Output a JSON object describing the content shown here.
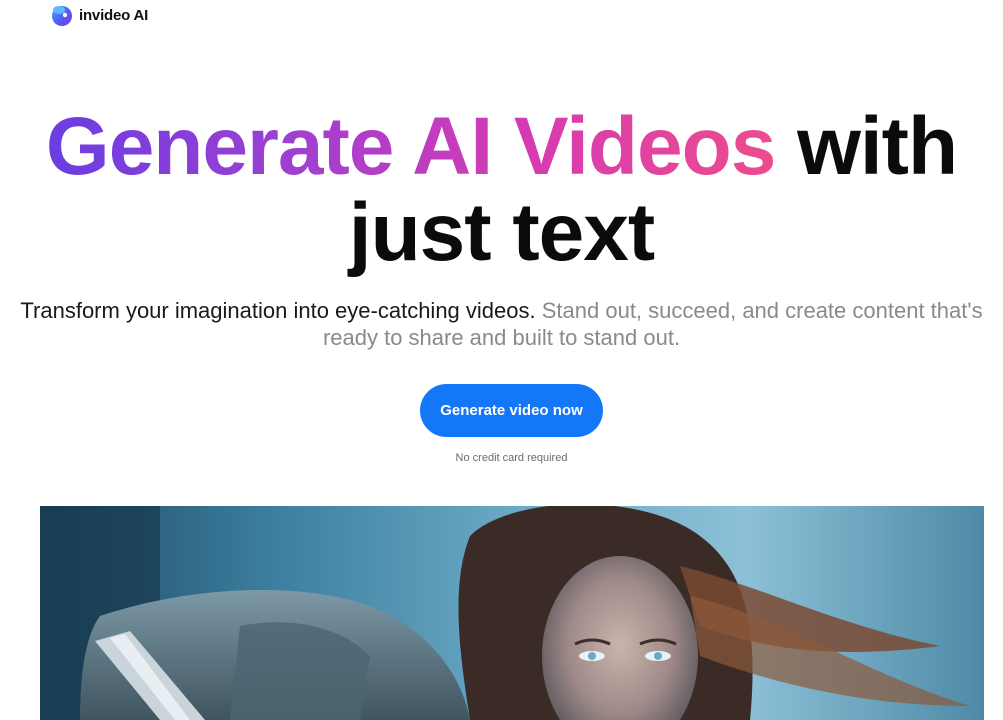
{
  "header": {
    "brand_name": "invideo AI",
    "logo_icon": "invideo-logo-icon"
  },
  "hero": {
    "headline_gradient": "Generate AI Videos",
    "headline_rest_line1": " with",
    "headline_line2": "just text",
    "subtitle_dark": "Transform your imagination into eye-catching videos.",
    "subtitle_light": " Stand out, succeed, and create content that's ready to share and built to stand out.",
    "cta_label": "Generate video now",
    "cta_note": "No credit card required"
  },
  "colors": {
    "gradient_start": "#6a3ee2",
    "gradient_end": "#ec4d8d",
    "cta_background": "#1477f8",
    "headline_dark": "#0b0b0b",
    "subtitle_gray": "#8a8a8a"
  },
  "media": {
    "hero_video_thumbnail": "warrior-woman-video-thumbnail"
  }
}
